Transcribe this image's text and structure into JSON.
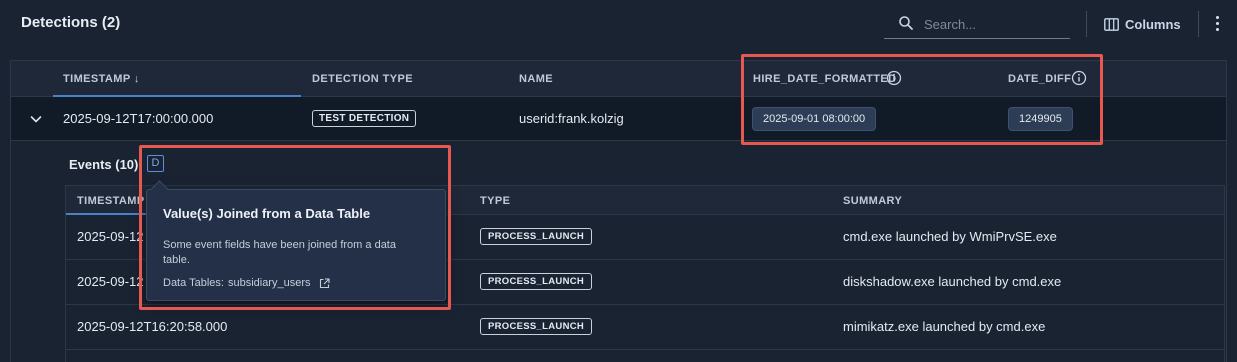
{
  "header": {
    "title": "Detections (2)",
    "search_placeholder": "Search...",
    "columns_label": "Columns"
  },
  "detections_table": {
    "columns": [
      "TIMESTAMP ↓",
      "DETECTION TYPE",
      "NAME",
      "HIRE_DATE_FORMATTED",
      "DATE_DIFF"
    ],
    "row": {
      "timestamp": "2025-09-12T17:00:00.000",
      "detection_type": "TEST DETECTION",
      "name": "userid:frank.kolzig",
      "hire_date_formatted": "2025-09-01 08:00:00",
      "date_diff": "1249905"
    }
  },
  "events": {
    "title": "Events (10)",
    "badge": "D",
    "columns": [
      "TIMESTAMP",
      "TYPE",
      "SUMMARY"
    ],
    "rows": [
      {
        "timestamp": "2025-09-12",
        "type": "PROCESS_LAUNCH",
        "summary": "cmd.exe launched by WmiPrvSE.exe"
      },
      {
        "timestamp": "2025-09-12",
        "type": "PROCESS_LAUNCH",
        "summary": "diskshadow.exe launched by cmd.exe"
      },
      {
        "timestamp": "2025-09-12T16:20:58.000",
        "type": "PROCESS_LAUNCH",
        "summary": "mimikatz.exe launched by cmd.exe"
      }
    ]
  },
  "tooltip": {
    "title": "Value(s) Joined from a Data Table",
    "body": "Some event fields have been joined from a data table.",
    "data_tables_label": "Data Tables:",
    "data_table_name": "subsidiary_users"
  },
  "colors": {
    "background": "#1a2332",
    "highlight": "#e65850",
    "accent": "#4a82c8"
  },
  "icons": [
    "search-icon",
    "columns-icon",
    "kebab-menu-icon",
    "chevron-down-icon",
    "info-icon",
    "external-link-icon"
  ]
}
